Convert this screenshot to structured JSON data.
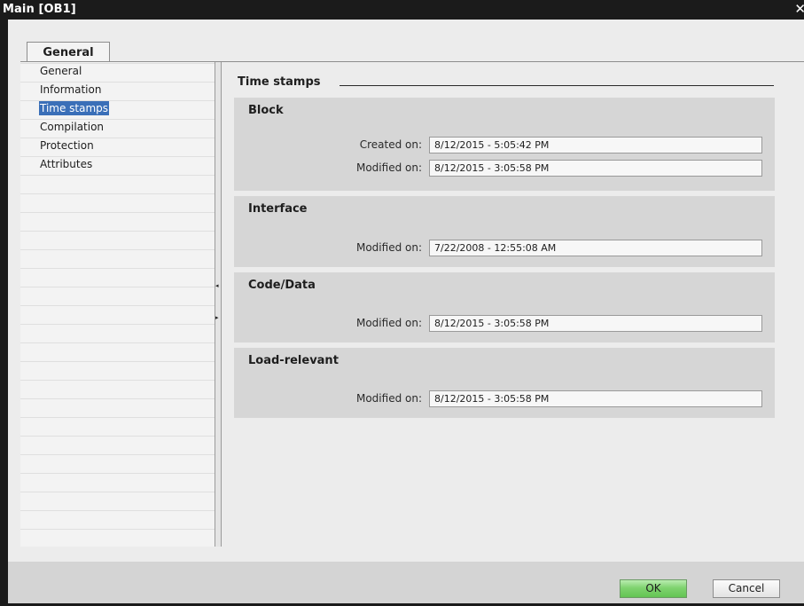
{
  "window": {
    "title": "Main [OB1]",
    "close_glyph": "✕"
  },
  "tabs": [
    {
      "label": "General",
      "active": true
    }
  ],
  "nav": {
    "items": [
      {
        "label": "General",
        "selected": false
      },
      {
        "label": "Information",
        "selected": false
      },
      {
        "label": "Time stamps",
        "selected": true
      },
      {
        "label": "Compilation",
        "selected": false
      },
      {
        "label": "Protection",
        "selected": false
      },
      {
        "label": "Attributes",
        "selected": false
      }
    ]
  },
  "splitter": {
    "collapse_glyph": "◂",
    "expand_glyph": "▸"
  },
  "section": {
    "title": "Time stamps",
    "groups": [
      {
        "title": "Block",
        "fields": [
          {
            "label": "Created on:",
            "value": "8/12/2015 - 5:05:42 PM"
          },
          {
            "label": "Modified on:",
            "value": "8/12/2015 - 3:05:58 PM"
          }
        ]
      },
      {
        "title": "Interface",
        "fields": [
          {
            "label": "Modified on:",
            "value": "7/22/2008 - 12:55:08 AM"
          }
        ]
      },
      {
        "title": "Code/Data",
        "fields": [
          {
            "label": "Modified on:",
            "value": "8/12/2015 - 3:05:58 PM"
          }
        ]
      },
      {
        "title": "Load-relevant",
        "fields": [
          {
            "label": "Modified on:",
            "value": "8/12/2015 - 3:05:58 PM"
          }
        ]
      }
    ]
  },
  "footer": {
    "ok_label": "OK",
    "cancel_label": "Cancel"
  },
  "colors": {
    "selection": "#3a6fb8",
    "ok_button": "#7fd36f",
    "group_bg": "#d6d6d6"
  }
}
